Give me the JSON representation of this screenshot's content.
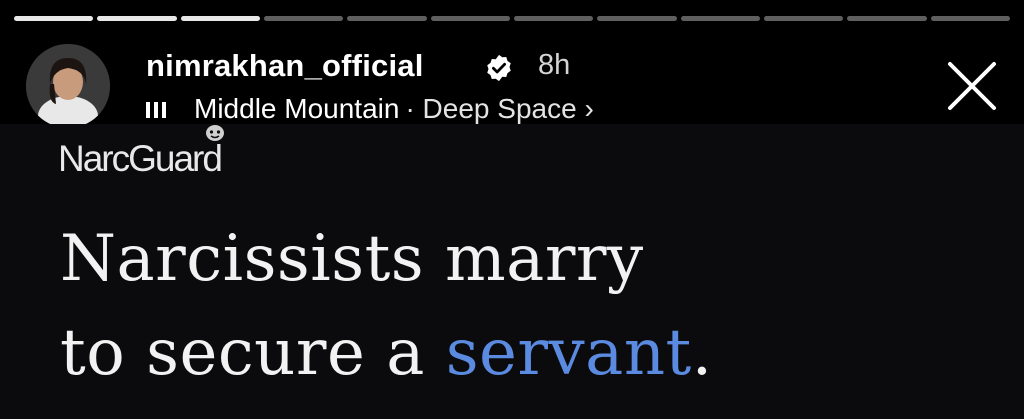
{
  "story": {
    "progress_total": 12,
    "progress_completed": 3
  },
  "header": {
    "username": "nimrakhan_official",
    "verified_icon": "verified-badge-icon",
    "time_ago": "8h",
    "music_icon": "music-bars-icon",
    "song": "Middle Mountain",
    "artist": "· Deep Space ›",
    "close_icon": "close-icon"
  },
  "post": {
    "brand": "NarcGuard",
    "headline_line1": "Narcissists marry",
    "headline_line2_prefix": "to secure a ",
    "headline_accent": "servant",
    "headline_suffix": "."
  },
  "colors": {
    "background": "#000000",
    "accent": "#5b8be0",
    "text": "#ffffff"
  }
}
